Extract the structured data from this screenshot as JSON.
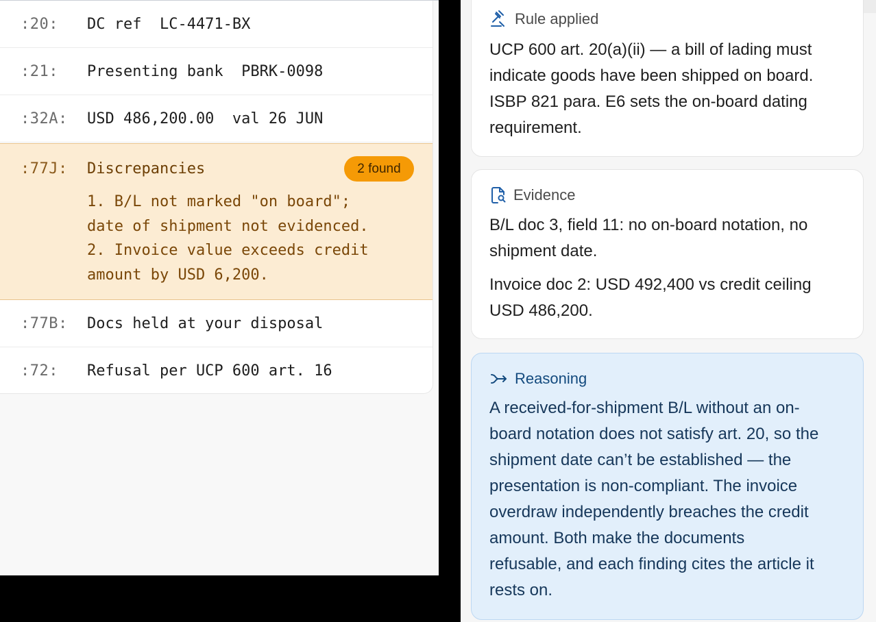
{
  "message": {
    "fields": [
      {
        "tag": ":20:",
        "value": "DC ref  LC-4471-BX"
      },
      {
        "tag": ":21:",
        "value": "Presenting bank  PBRK-0098"
      },
      {
        "tag": ":32A:",
        "value": "USD 486,200.00  val 26 JUN"
      }
    ],
    "discrepancies": {
      "tag": ":77J:",
      "title": "Discrepancies",
      "badge": "2 found",
      "lines": [
        "1. B/L not marked \"on board\";",
        "date of shipment not evidenced.",
        "2. Invoice value exceeds credit",
        "amount by USD 6,200."
      ]
    },
    "trailing_fields": [
      {
        "tag": ":77B:",
        "value": "Docs held at your disposal"
      },
      {
        "tag": ":72:",
        "value": "Refusal per UCP 600 art. 16"
      }
    ]
  },
  "rule_card": {
    "icon": "gavel-icon",
    "heading": "Rule applied",
    "lines": [
      "UCP 600 art. 20(a)(ii) — a bill of lading must",
      "indicate goods have been shipped on board.",
      "ISBP 821 para. E6 sets the on-board dating",
      "requirement."
    ]
  },
  "evidence_card": {
    "icon": "document-search-icon",
    "heading": "Evidence",
    "paragraph1": [
      "B/L doc 3, field 11: no on-board notation, no",
      "shipment date."
    ],
    "paragraph2": [
      "Invoice doc 2: USD 492,400 vs credit ceiling",
      "USD 486,200."
    ]
  },
  "reasoning_card": {
    "icon": "arrow-chain-icon",
    "heading": "Reasoning",
    "lines": [
      "A received-for-shipment B/L without an on-",
      "board notation does not satisfy art. 20, so the",
      "shipment date can’t be established — the",
      "presentation is non-compliant. The invoice",
      "overdraw independently breaches the credit",
      "amount. Both make the documents",
      "refusable, and each finding cites the article it",
      "rests on."
    ]
  },
  "colors": {
    "discrepancy_bg": "#fcecd3",
    "badge": "#f59a06",
    "reasoning_bg": "#e2effb",
    "reasoning_text": "#16375a",
    "icon_blue": "#1f5fa8"
  }
}
